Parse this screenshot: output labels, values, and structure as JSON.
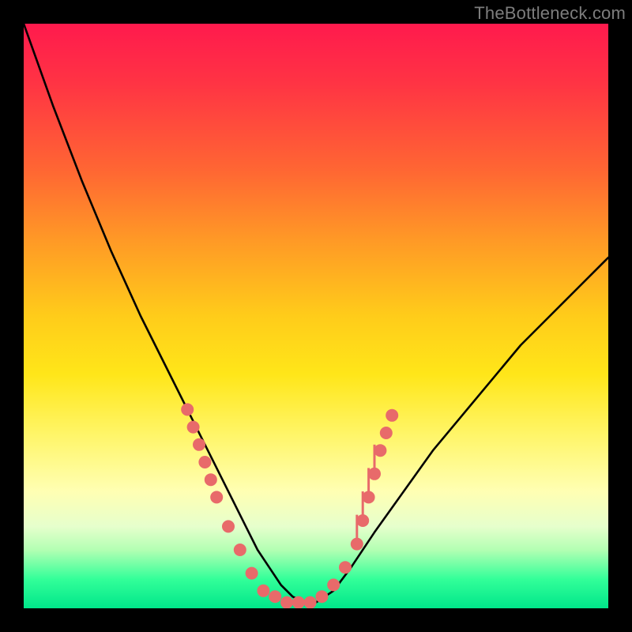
{
  "watermark": "TheBottleneck.com",
  "chart_data": {
    "type": "line",
    "title": "",
    "xlabel": "",
    "ylabel": "",
    "xlim": [
      0,
      100
    ],
    "ylim": [
      0,
      100
    ],
    "series": [
      {
        "name": "curve",
        "x": [
          0,
          5,
          10,
          15,
          20,
          25,
          28,
          30,
          32,
          34,
          36,
          38,
          40,
          42,
          44,
          46,
          48,
          50,
          53,
          56,
          60,
          65,
          70,
          75,
          80,
          85,
          90,
          95,
          100
        ],
        "y": [
          100,
          86,
          73,
          61,
          50,
          40,
          34,
          30,
          26,
          22,
          18,
          14,
          10,
          7,
          4,
          2,
          1,
          1,
          3,
          7,
          13,
          20,
          27,
          33,
          39,
          45,
          50,
          55,
          60
        ]
      }
    ],
    "markers": {
      "name": "dots",
      "color": "#e86a6a",
      "points": [
        {
          "x": 28,
          "y": 34
        },
        {
          "x": 29,
          "y": 31
        },
        {
          "x": 30,
          "y": 28
        },
        {
          "x": 31,
          "y": 25
        },
        {
          "x": 32,
          "y": 22
        },
        {
          "x": 33,
          "y": 19
        },
        {
          "x": 35,
          "y": 14
        },
        {
          "x": 37,
          "y": 10
        },
        {
          "x": 39,
          "y": 6
        },
        {
          "x": 41,
          "y": 3
        },
        {
          "x": 43,
          "y": 2
        },
        {
          "x": 45,
          "y": 1
        },
        {
          "x": 47,
          "y": 1
        },
        {
          "x": 49,
          "y": 1
        },
        {
          "x": 51,
          "y": 2
        },
        {
          "x": 53,
          "y": 4
        },
        {
          "x": 55,
          "y": 7
        },
        {
          "x": 57,
          "y": 11
        },
        {
          "x": 58,
          "y": 15
        },
        {
          "x": 59,
          "y": 19
        },
        {
          "x": 60,
          "y": 23
        },
        {
          "x": 61,
          "y": 27
        },
        {
          "x": 62,
          "y": 30
        },
        {
          "x": 63,
          "y": 33
        }
      ],
      "ticks": [
        {
          "x": 57,
          "y0": 11,
          "y1": 16
        },
        {
          "x": 58,
          "y0": 15,
          "y1": 20
        },
        {
          "x": 59,
          "y0": 19,
          "y1": 24
        },
        {
          "x": 60,
          "y0": 23,
          "y1": 28
        }
      ]
    }
  }
}
